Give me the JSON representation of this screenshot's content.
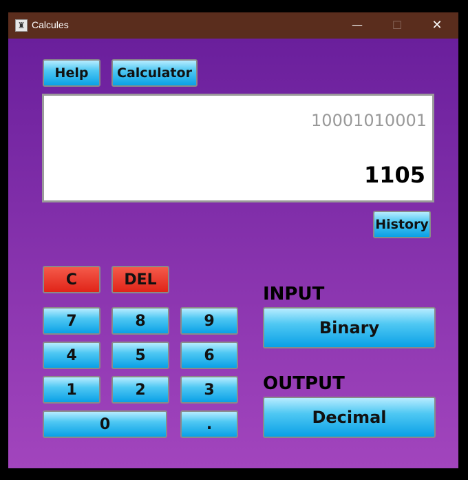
{
  "window": {
    "title": "Calcules",
    "minimize_glyph": "—",
    "maximize_glyph": "☐",
    "close_glyph": "✕"
  },
  "top_buttons": {
    "help": "Help",
    "calculator": "Calculator"
  },
  "display": {
    "expression": "10001010001",
    "result": "1105"
  },
  "history_label": "History",
  "keys": {
    "clear": "C",
    "delete": "DEL",
    "k7": "7",
    "k8": "8",
    "k9": "9",
    "k4": "4",
    "k5": "5",
    "k6": "6",
    "k1": "1",
    "k2": "2",
    "k3": "3",
    "k0": "0",
    "dot": "."
  },
  "input": {
    "label": "INPUT",
    "value": "Binary"
  },
  "output": {
    "label": "OUTPUT",
    "value": "Decimal"
  },
  "colors": {
    "titlebar": "#5a2d1d",
    "bg_top": "#6a1f9c",
    "bg_bottom": "#a245bd",
    "button_blue": "#0aa0e6",
    "button_red": "#e02418"
  }
}
